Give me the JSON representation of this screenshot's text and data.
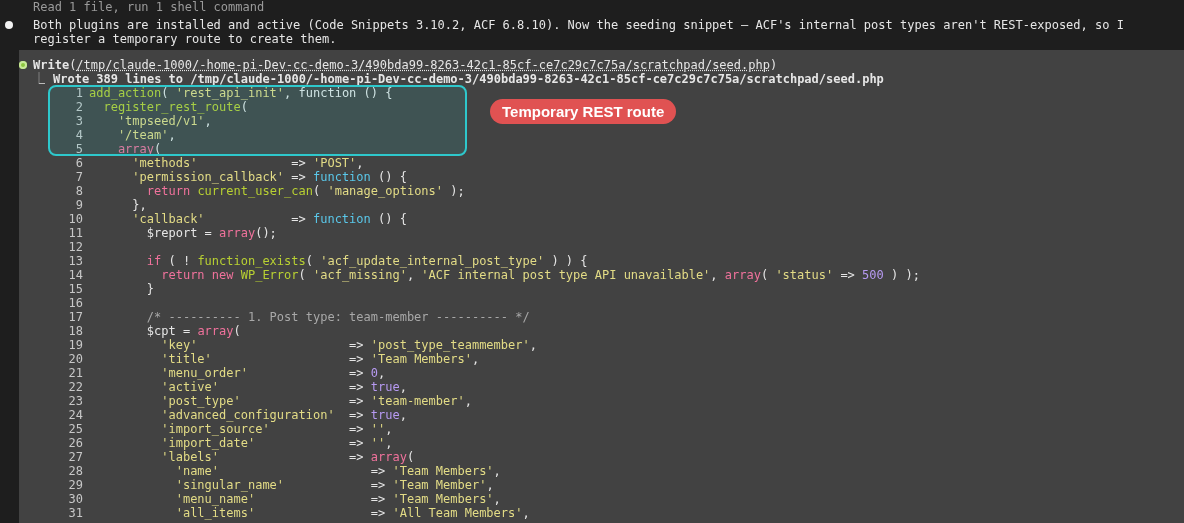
{
  "summary_line": "Read 1 file, run 1 shell command",
  "message": "Both plugins are installed and active (Code Snippets 3.10.2, ACF 6.8.10). Now the seeding snippet — ACF's internal post types aren't REST-exposed, so I register a temporary route to create them.",
  "tool_call": {
    "name": "Write",
    "open": "(",
    "path": "/tmp/claude-1000/-home-pi-Dev-cc-demo-3/490bda99-8263-42c1-85cf-ce7c29c7c75a/scratchpad/seed.php",
    "close": ")",
    "result_mark": "⎿",
    "result": "Wrote 389 lines to /tmp/claude-1000/-home-pi-Dev-cc-demo-3/490bda99-8263-42c1-85cf-ce7c29c7c75a/scratchpad/seed.php"
  },
  "annotation": {
    "label": "Temporary REST route"
  },
  "code_lines": [
    {
      "number": "1",
      "tokens": [
        {
          "kind": "fn",
          "text": "add_action"
        },
        {
          "kind": "p",
          "text": "( "
        },
        {
          "kind": "s",
          "text": "'rest_api_init'"
        },
        {
          "kind": "p",
          "text": ", function () {"
        }
      ]
    },
    {
      "number": "2",
      "tokens": [
        {
          "kind": "fn",
          "text": "  register_rest_route"
        },
        {
          "kind": "p",
          "text": "("
        }
      ]
    },
    {
      "number": "3",
      "tokens": [
        {
          "kind": "s",
          "text": "    'tmpseed/v1'"
        },
        {
          "kind": "p",
          "text": ","
        }
      ]
    },
    {
      "number": "4",
      "tokens": [
        {
          "kind": "s",
          "text": "    '/team'"
        },
        {
          "kind": "p",
          "text": ","
        }
      ]
    },
    {
      "number": "5",
      "tokens": [
        {
          "kind": "kw",
          "text": "    array"
        },
        {
          "kind": "p",
          "text": "("
        }
      ]
    },
    {
      "number": "6",
      "tokens": [
        {
          "kind": "s",
          "text": "      'methods'"
        },
        {
          "kind": "p",
          "text": "             => "
        },
        {
          "kind": "s",
          "text": "'POST'"
        },
        {
          "kind": "p",
          "text": ","
        }
      ]
    },
    {
      "number": "7",
      "tokens": [
        {
          "kind": "s",
          "text": "      'permission_callback'"
        },
        {
          "kind": "p",
          "text": " => "
        },
        {
          "kind": "fb",
          "text": "function"
        },
        {
          "kind": "p",
          "text": " () {"
        }
      ]
    },
    {
      "number": "8",
      "tokens": [
        {
          "kind": "kw",
          "text": "        return"
        },
        {
          "kind": "fn",
          "text": " current_user_can"
        },
        {
          "kind": "p",
          "text": "( "
        },
        {
          "kind": "s",
          "text": "'manage_options'"
        },
        {
          "kind": "p",
          "text": " );"
        }
      ]
    },
    {
      "number": "9",
      "tokens": [
        {
          "kind": "p",
          "text": "      },"
        }
      ]
    },
    {
      "number": "10",
      "tokens": [
        {
          "kind": "s",
          "text": "      'callback'"
        },
        {
          "kind": "p",
          "text": "            => "
        },
        {
          "kind": "fb",
          "text": "function"
        },
        {
          "kind": "p",
          "text": " () {"
        }
      ]
    },
    {
      "number": "11",
      "tokens": [
        {
          "kind": "p",
          "text": "        $report = "
        },
        {
          "kind": "kw",
          "text": "array"
        },
        {
          "kind": "p",
          "text": "();"
        }
      ]
    },
    {
      "number": "12"
    },
    {
      "number": "13",
      "tokens": [
        {
          "kind": "kw",
          "text": "        if"
        },
        {
          "kind": "p",
          "text": " ( ! "
        },
        {
          "kind": "fn",
          "text": "function_exists"
        },
        {
          "kind": "p",
          "text": "( "
        },
        {
          "kind": "s",
          "text": "'acf_update_internal_post_type'"
        },
        {
          "kind": "p",
          "text": " ) ) {"
        }
      ]
    },
    {
      "number": "14",
      "tokens": [
        {
          "kind": "kw",
          "text": "          return new"
        },
        {
          "kind": "fn",
          "text": " WP_Error"
        },
        {
          "kind": "p",
          "text": "( "
        },
        {
          "kind": "s",
          "text": "'acf_missing'"
        },
        {
          "kind": "p",
          "text": ", "
        },
        {
          "kind": "s",
          "text": "'ACF internal post type API unavailable'"
        },
        {
          "kind": "p",
          "text": ", "
        },
        {
          "kind": "kw",
          "text": "array"
        },
        {
          "kind": "p",
          "text": "( "
        },
        {
          "kind": "s",
          "text": "'status'"
        },
        {
          "kind": "p",
          "text": " => "
        },
        {
          "kind": "n",
          "text": "500"
        },
        {
          "kind": "p",
          "text": " ) );"
        }
      ]
    },
    {
      "number": "15",
      "tokens": [
        {
          "kind": "p",
          "text": "        }"
        }
      ]
    },
    {
      "number": "16"
    },
    {
      "number": "17",
      "tokens": [
        {
          "kind": "c",
          "text": "        /* ---------- 1. Post type: team-member ---------- */"
        }
      ]
    },
    {
      "number": "18",
      "tokens": [
        {
          "kind": "p",
          "text": "        $cpt = "
        },
        {
          "kind": "kw",
          "text": "array"
        },
        {
          "kind": "p",
          "text": "("
        }
      ]
    },
    {
      "number": "19",
      "tokens": [
        {
          "kind": "s",
          "text": "          'key'"
        },
        {
          "kind": "p",
          "text": "                     => "
        },
        {
          "kind": "s",
          "text": "'post_type_teammember'"
        },
        {
          "kind": "p",
          "text": ","
        }
      ]
    },
    {
      "number": "20",
      "tokens": [
        {
          "kind": "s",
          "text": "          'title'"
        },
        {
          "kind": "p",
          "text": "                   => "
        },
        {
          "kind": "s",
          "text": "'Team Members'"
        },
        {
          "kind": "p",
          "text": ","
        }
      ]
    },
    {
      "number": "21",
      "tokens": [
        {
          "kind": "s",
          "text": "          'menu_order'"
        },
        {
          "kind": "p",
          "text": "              => "
        },
        {
          "kind": "n",
          "text": "0"
        },
        {
          "kind": "p",
          "text": ","
        }
      ]
    },
    {
      "number": "22",
      "tokens": [
        {
          "kind": "s",
          "text": "          'active'"
        },
        {
          "kind": "p",
          "text": "                  => "
        },
        {
          "kind": "n",
          "text": "true"
        },
        {
          "kind": "p",
          "text": ","
        }
      ]
    },
    {
      "number": "23",
      "tokens": [
        {
          "kind": "s",
          "text": "          'post_type'"
        },
        {
          "kind": "p",
          "text": "               => "
        },
        {
          "kind": "s",
          "text": "'team-member'"
        },
        {
          "kind": "p",
          "text": ","
        }
      ]
    },
    {
      "number": "24",
      "tokens": [
        {
          "kind": "s",
          "text": "          'advanced_configuration'"
        },
        {
          "kind": "p",
          "text": "  => "
        },
        {
          "kind": "n",
          "text": "true"
        },
        {
          "kind": "p",
          "text": ","
        }
      ]
    },
    {
      "number": "25",
      "tokens": [
        {
          "kind": "s",
          "text": "          'import_source'"
        },
        {
          "kind": "p",
          "text": "           => "
        },
        {
          "kind": "s",
          "text": "''"
        },
        {
          "kind": "p",
          "text": ","
        }
      ]
    },
    {
      "number": "26",
      "tokens": [
        {
          "kind": "s",
          "text": "          'import_date'"
        },
        {
          "kind": "p",
          "text": "             => "
        },
        {
          "kind": "s",
          "text": "''"
        },
        {
          "kind": "p",
          "text": ","
        }
      ]
    },
    {
      "number": "27",
      "tokens": [
        {
          "kind": "s",
          "text": "          'labels'"
        },
        {
          "kind": "p",
          "text": "                  => "
        },
        {
          "kind": "kw",
          "text": "array"
        },
        {
          "kind": "p",
          "text": "("
        }
      ]
    },
    {
      "number": "28",
      "tokens": [
        {
          "kind": "s",
          "text": "            'name'"
        },
        {
          "kind": "p",
          "text": "                     => "
        },
        {
          "kind": "s",
          "text": "'Team Members'"
        },
        {
          "kind": "p",
          "text": ","
        }
      ]
    },
    {
      "number": "29",
      "tokens": [
        {
          "kind": "s",
          "text": "            'singular_name'"
        },
        {
          "kind": "p",
          "text": "            => "
        },
        {
          "kind": "s",
          "text": "'Team Member'"
        },
        {
          "kind": "p",
          "text": ","
        }
      ]
    },
    {
      "number": "30",
      "tokens": [
        {
          "kind": "s",
          "text": "            'menu_name'"
        },
        {
          "kind": "p",
          "text": "                => "
        },
        {
          "kind": "s",
          "text": "'Team Members'"
        },
        {
          "kind": "p",
          "text": ","
        }
      ]
    },
    {
      "number": "31",
      "tokens": [
        {
          "kind": "s",
          "text": "            'all_items'"
        },
        {
          "kind": "p",
          "text": "                => "
        },
        {
          "kind": "s",
          "text": "'All Team Members'"
        },
        {
          "kind": "p",
          "text": ","
        }
      ]
    }
  ]
}
